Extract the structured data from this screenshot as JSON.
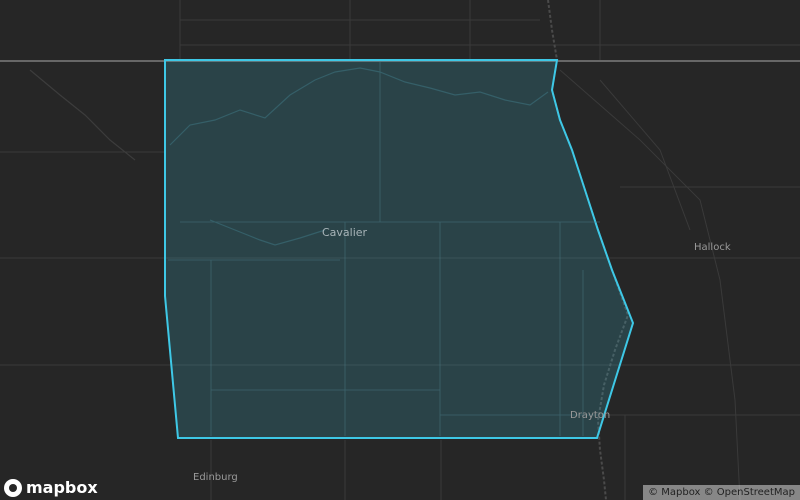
{
  "map": {
    "background_color": "#262626",
    "highlight_color": "#3ec8e6",
    "places": {
      "cavalier": "Cavalier",
      "hallock": "Hallock",
      "drayton": "Drayton",
      "edinburg": "Edinburg"
    }
  },
  "branding": {
    "logo_text": "mapbox",
    "logo_icon": "mapbox-logo-icon"
  },
  "attribution": {
    "mapbox": "© Mapbox",
    "osm": "© OpenStreetMap"
  }
}
